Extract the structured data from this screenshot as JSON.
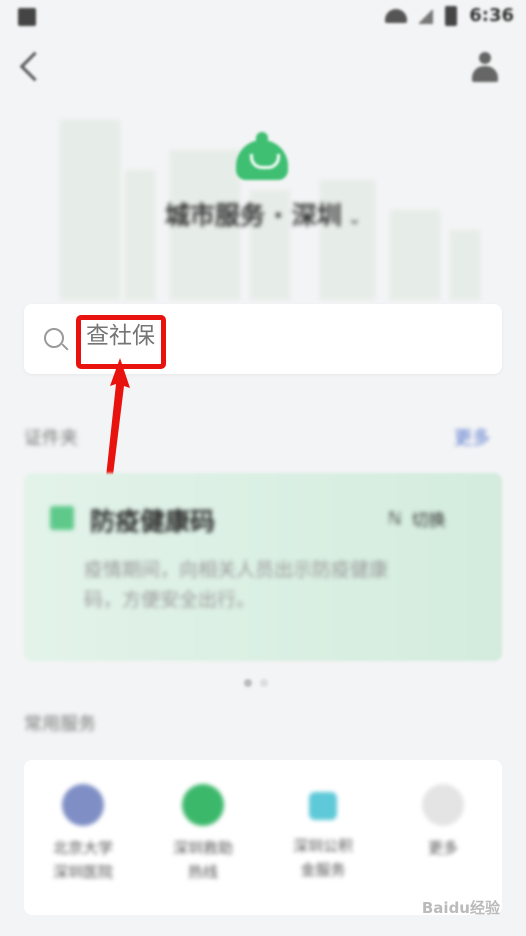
{
  "status_bar": {
    "time": "6:36"
  },
  "header": {
    "title": "城市服务 · 深圳",
    "dropdown_symbol": "⌄"
  },
  "search": {
    "placeholder": "查社保"
  },
  "section_cards": {
    "label": "证件夹",
    "more": "更多"
  },
  "card": {
    "title": "防疫健康码",
    "switch_label": "切换",
    "switch_prefix": "ℕ",
    "description": "疫情期间，向相关人员出示防疫健康码，方便安全出行。"
  },
  "section_services": {
    "label": "常用服务"
  },
  "services": [
    {
      "label": "北京大学\n深圳医院",
      "icon_color": "#7f8fc5",
      "icon": "hospital-icon"
    },
    {
      "label": "深圳救助\n热线",
      "icon_color": "#3cb86b",
      "icon": "hotline-icon"
    },
    {
      "label": "深圳公积\n金服务",
      "icon_color": "#5ec9d8",
      "icon": "fund-icon"
    },
    {
      "label": "更多",
      "icon_color": "#e4e4e4",
      "icon": "more-icon"
    }
  ],
  "watermark": "Baidu经验"
}
